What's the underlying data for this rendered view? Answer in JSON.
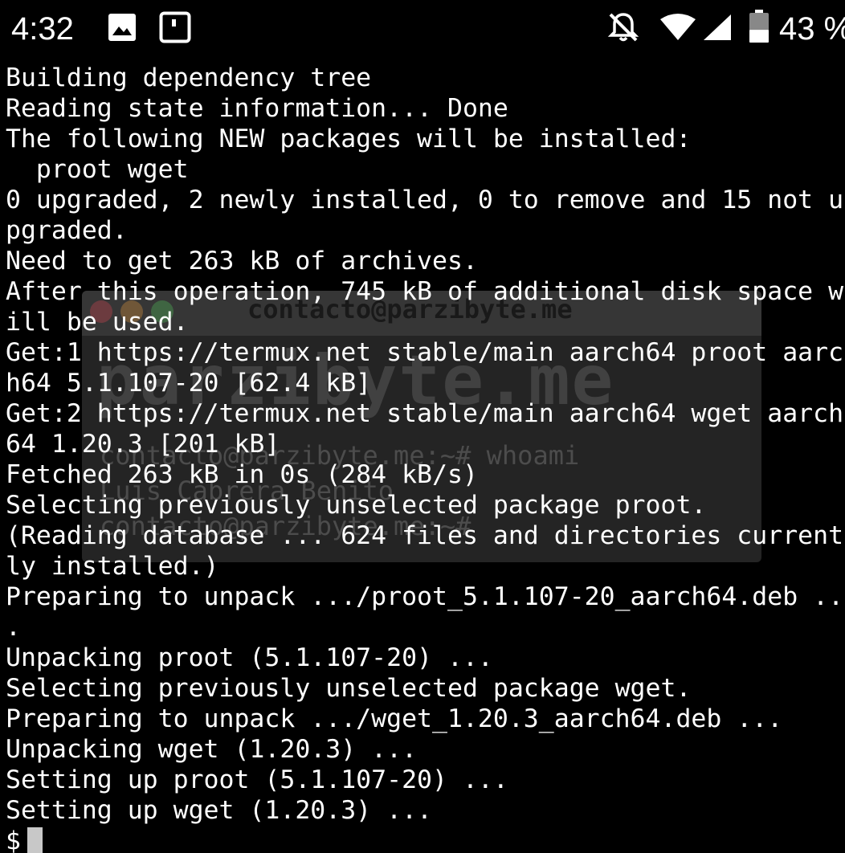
{
  "status_bar": {
    "time": "4:32",
    "battery_percent": "43 %",
    "icons": [
      "image-notification-icon",
      "app-notification-icon",
      "notifications-off-icon",
      "wifi-icon",
      "cell-signal-icon",
      "battery-icon"
    ],
    "battery_level": 0.43
  },
  "watermark": {
    "title": "contacto@parzibyte.me",
    "big_text": "parzibyte.me",
    "line1": "contacto@parzibyte.me:~# whoami",
    "line2": "Luis Cabrera Benito",
    "line3": "contacto@parzibyte.me:~#"
  },
  "terminal": {
    "lines": [
      "Building dependency tree",
      "Reading state information... Done",
      "The following NEW packages will be installed:",
      "  proot wget",
      "0 upgraded, 2 newly installed, 0 to remove and 15 not u",
      "pgraded.",
      "Need to get 263 kB of archives.",
      "After this operation, 745 kB of additional disk space w",
      "ill be used.",
      "Get:1 https://termux.net stable/main aarch64 proot aarc",
      "h64 5.1.107-20 [62.4 kB]",
      "Get:2 https://termux.net stable/main aarch64 wget aarch",
      "64 1.20.3 [201 kB]",
      "Fetched 263 kB in 0s (284 kB/s)",
      "Selecting previously unselected package proot.",
      "(Reading database ... 624 files and directories current",
      "ly installed.)",
      "Preparing to unpack .../proot_5.1.107-20_aarch64.deb ..",
      ".",
      "Unpacking proot (5.1.107-20) ...",
      "Selecting previously unselected package wget.",
      "Preparing to unpack .../wget_1.20.3_aarch64.deb ...",
      "Unpacking wget (1.20.3) ...",
      "Setting up proot (5.1.107-20) ...",
      "Setting up wget (1.20.3) ..."
    ],
    "prompt": "$"
  }
}
